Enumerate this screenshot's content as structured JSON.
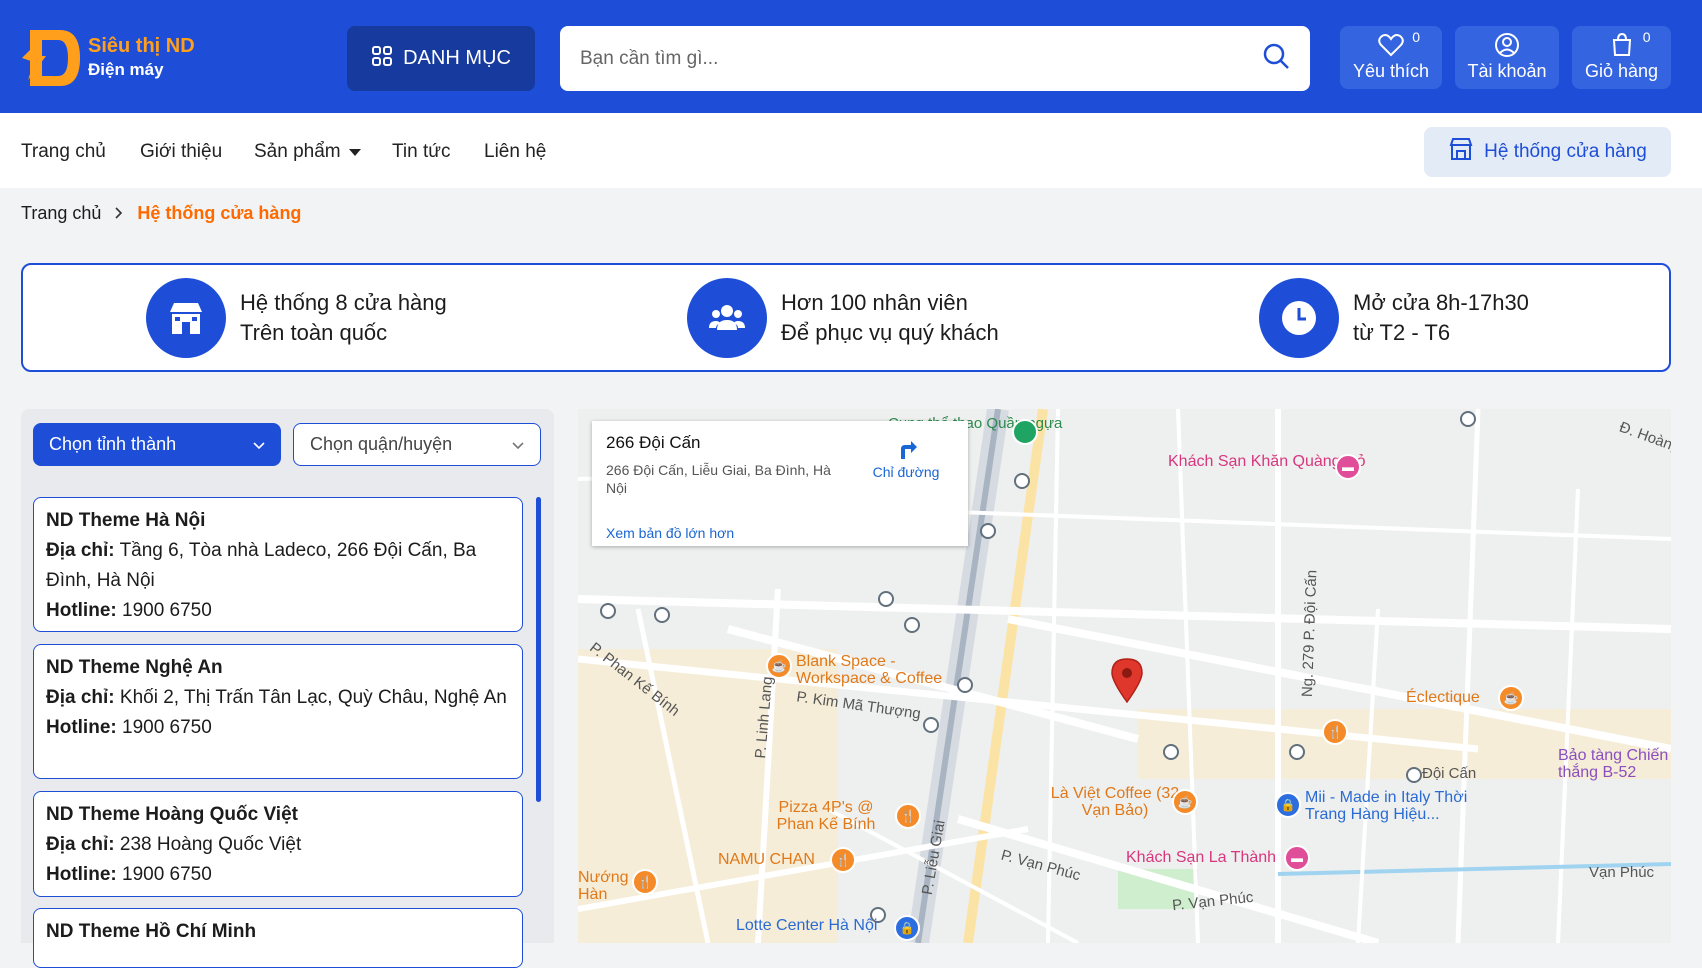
{
  "header": {
    "logo": {
      "name": "Siêu thị ND",
      "sub": "Điện máy"
    },
    "danh_muc_label": "DANH MỤC",
    "search": {
      "placeholder": "Bạn cần tìm gì...",
      "value": ""
    },
    "actions": [
      {
        "label": "Yêu thích",
        "badge": "0",
        "icon": "heart-icon"
      },
      {
        "label": "Tài khoản",
        "badge": "",
        "icon": "user-icon"
      },
      {
        "label": "Giỏ hàng",
        "badge": "0",
        "icon": "cart-icon"
      }
    ]
  },
  "nav": {
    "items": [
      "Trang chủ",
      "Giới thiệu",
      "Sản phẩm",
      "Tin tức",
      "Liên hệ"
    ],
    "store_system_button": "Hệ thống cửa hàng"
  },
  "breadcrumb": {
    "home": "Trang chủ",
    "current": "Hệ thống cửa hàng"
  },
  "features": [
    {
      "line1": "Hệ thống 8 cửa hàng",
      "line2": "Trên toàn quốc",
      "icon": "store-icon"
    },
    {
      "line1": "Hơn 100 nhân viên",
      "line2": "Để phục vụ quý khách",
      "icon": "users-icon"
    },
    {
      "line1": "Mở cửa 8h-17h30",
      "line2": "từ T2 - T6",
      "icon": "clock-icon"
    }
  ],
  "filters": {
    "province": "Chọn tỉnh thành",
    "district": "Chọn quận/huyện"
  },
  "labels": {
    "address": "Địa chỉ:",
    "hotline": "Hotline:"
  },
  "stores": [
    {
      "name": "ND Theme Hà Nội",
      "address": "Tầng 6, Tòa nhà Ladeco, 266 Đội Cấn, Ba Đình, Hà Nội",
      "hotline": "1900 6750"
    },
    {
      "name": "ND Theme Nghệ An",
      "address": "Khối 2, Thị Trấn Tân Lạc, Quỳ Châu, Nghệ An",
      "hotline": "1900 6750"
    },
    {
      "name": "ND Theme Hoàng Quốc Việt",
      "address": "238 Hoàng Quốc Việt",
      "hotline": "1900 6750"
    },
    {
      "name": "ND Theme Hồ Chí Minh",
      "address": "",
      "hotline": ""
    }
  ],
  "map": {
    "card_title": "266 Đội Cấn",
    "card_address": "266 Đội Cấn, Liễu Giai, Ba Đình, Hà Nội",
    "directions_label": "Chỉ đường",
    "larger_map_link": "Xem bản đồ lớn hơn",
    "pois": [
      "Khách Sạn Khăn Quàng Đỏ",
      "Blank Space - Workspace & Coffee",
      "Éclectique",
      "Bảo tàng Chiến thắng B-52",
      "Là Việt Coffee (32 Vạn Bảo)",
      "Mii - Made in Italy Thời Trang Hàng Hiệu...",
      "Pizza 4P's @ Phan Kế Bính",
      "NAMU CHAN",
      "Khách Sạn La Thành",
      "Nướng Hàn",
      "Lotte Center Hà Nội"
    ],
    "streets": [
      "P. Phan Kế Bính",
      "P. Linh Lang",
      "P. Kim Mã Thượng",
      "P. Liễu Giai",
      "P. Vạn Phúc",
      "Ng. 279 P. Đội Cấn",
      "Đội Cấn",
      "Vạn Phúc",
      "P. Vạn Phúc",
      "Đ. Hoàng",
      "Cung thể thao Quần ngựa"
    ]
  }
}
